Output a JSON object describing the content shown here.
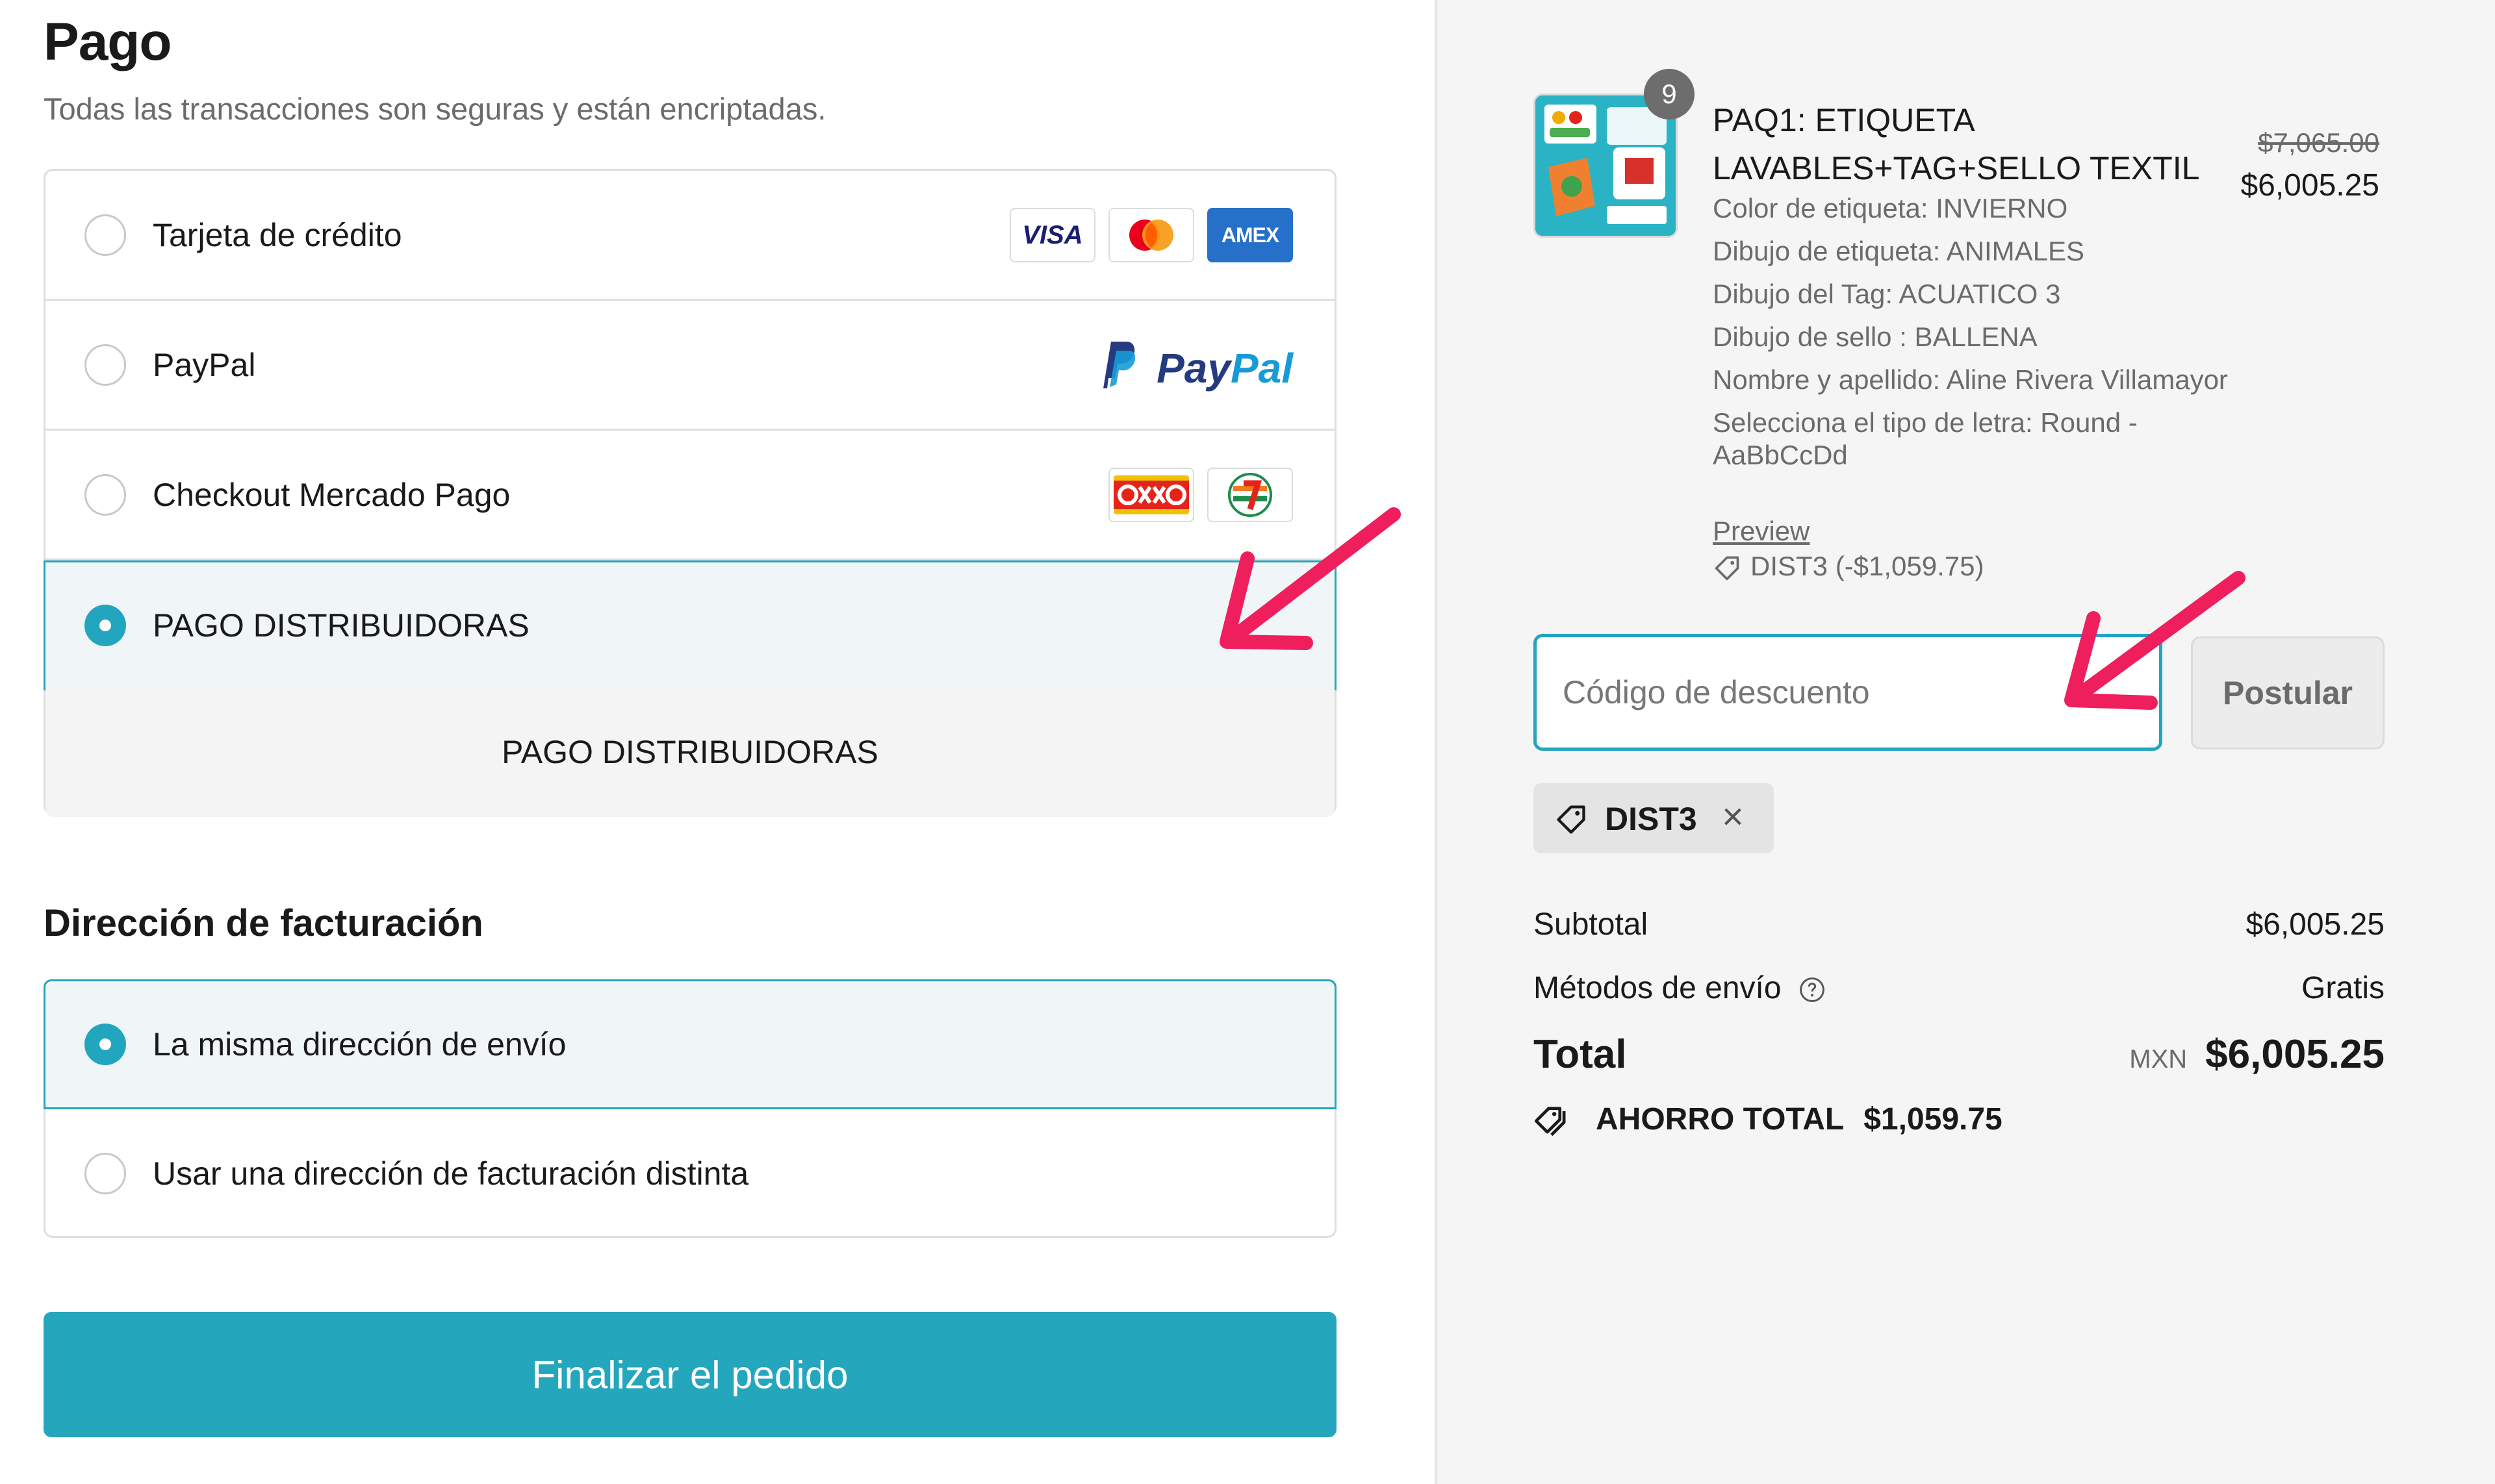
{
  "payment": {
    "title": "Pago",
    "subtitle": "Todas las transacciones son seguras y están encriptadas.",
    "options": [
      {
        "label": "Tarjeta de crédito",
        "selected": false,
        "icons": [
          "visa-icon",
          "mastercard-icon",
          "amex-icon"
        ]
      },
      {
        "label": "PayPal",
        "selected": false,
        "icons": [
          "paypal-logo"
        ]
      },
      {
        "label": "Checkout Mercado Pago",
        "selected": false,
        "icons": [
          "oxxo-icon",
          "seven-eleven-icon"
        ]
      },
      {
        "label": "PAGO DISTRIBUIDORAS",
        "selected": true
      }
    ],
    "selected_detail": "PAGO DISTRIBUIDORAS",
    "card_brands": {
      "visa": "VISA",
      "amex": "AMEX"
    },
    "paypal_text": {
      "pay": "Pay",
      "pal": "Pal"
    }
  },
  "billing": {
    "title": "Dirección de facturación",
    "options": [
      {
        "label": "La misma dirección de envío",
        "selected": true
      },
      {
        "label": "Usar una dirección de facturación distinta",
        "selected": false
      }
    ]
  },
  "submit_label": "Finalizar el pedido",
  "summary": {
    "item": {
      "quantity": "9",
      "name": "PAQ1: ETIQUETA LAVABLES+TAG+SELLO TEXTIL",
      "price_original": "$7,065.00",
      "price_final": "$6,005.25",
      "properties": [
        "Color de etiqueta: INVIERNO",
        "Dibujo de etiqueta: ANIMALES",
        "Dibujo del Tag: ACUATICO 3",
        "Dibujo de sello : BALLENA",
        "Nombre y apellido: Aline Rivera Villamayor",
        "Selecciona el tipo de letra: Round - AaBbCcDd"
      ],
      "preview_link": "Preview",
      "discount_line": "DIST3 (-$1,059.75)"
    },
    "discount_input": {
      "placeholder": "Código de descuento",
      "value": ""
    },
    "apply_label": "Postular",
    "applied_code": "DIST3",
    "subtotal_label": "Subtotal",
    "subtotal_value": "$6,005.25",
    "shipping_label": "Métodos de envío",
    "shipping_value": "Gratis",
    "total_label": "Total",
    "currency": "MXN",
    "total_value": "$6,005.25",
    "savings_label": "AHORRO TOTAL",
    "savings_value": "$1,059.75"
  },
  "colors": {
    "accent": "#24a6bd",
    "annotation_arrow": "#ee1f5c",
    "paypal_dark": "#253b80",
    "paypal_light": "#179bd7"
  }
}
